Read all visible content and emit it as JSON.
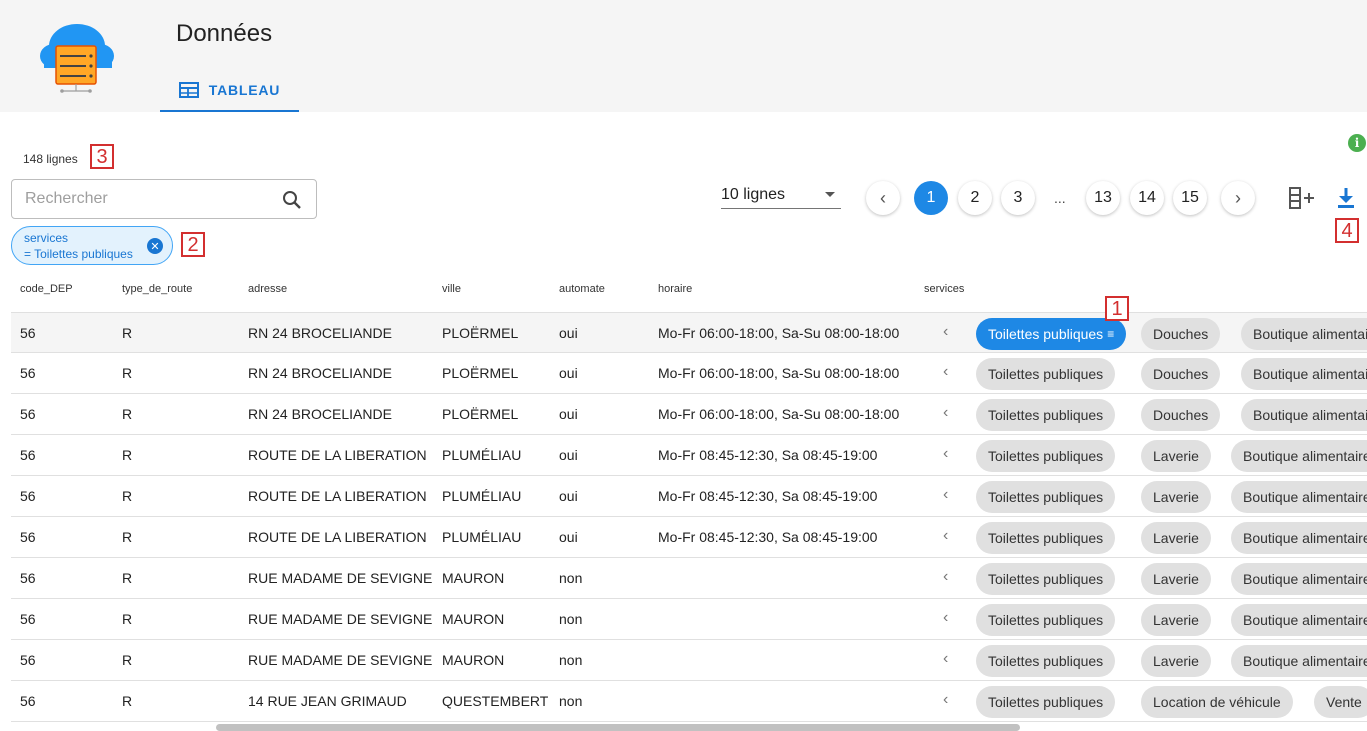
{
  "header": {
    "title": "Données",
    "tab_label": "TABLEAU"
  },
  "row_count": "148 lignes",
  "search": {
    "placeholder": "Rechercher"
  },
  "filter_chip": {
    "line1": "services",
    "line2": "= Toilettes publiques"
  },
  "rows_per_page": "10 lignes",
  "pagination": {
    "pages": [
      "1",
      "2",
      "3",
      "...",
      "13",
      "14",
      "15"
    ],
    "current": "1"
  },
  "annotations": [
    "1",
    "2",
    "3",
    "4"
  ],
  "table": {
    "columns": [
      "code_DEP",
      "type_de_route",
      "adresse",
      "ville",
      "automate",
      "horaire",
      "services"
    ],
    "rows": [
      {
        "code_DEP": "56",
        "type_de_route": "R",
        "adresse": "RN 24 BROCELIANDE",
        "ville": "PLOËRMEL",
        "automate": "oui",
        "horaire": "Mo-Fr 06:00-18:00, Sa-Su 08:00-18:00",
        "services": [
          "Toilettes publiques",
          "Douches",
          "Boutique alimentaire"
        ]
      },
      {
        "code_DEP": "56",
        "type_de_route": "R",
        "adresse": "RN 24 BROCELIANDE",
        "ville": "PLOËRMEL",
        "automate": "oui",
        "horaire": "Mo-Fr 06:00-18:00, Sa-Su 08:00-18:00",
        "services": [
          "Toilettes publiques",
          "Douches",
          "Boutique alimentaire"
        ]
      },
      {
        "code_DEP": "56",
        "type_de_route": "R",
        "adresse": "RN 24 BROCELIANDE",
        "ville": "PLOËRMEL",
        "automate": "oui",
        "horaire": "Mo-Fr 06:00-18:00, Sa-Su 08:00-18:00",
        "services": [
          "Toilettes publiques",
          "Douches",
          "Boutique alimentaire"
        ]
      },
      {
        "code_DEP": "56",
        "type_de_route": "R",
        "adresse": "ROUTE DE LA LIBERATION",
        "ville": "PLUMÉLIAU",
        "automate": "oui",
        "horaire": "Mo-Fr 08:45-12:30, Sa 08:45-19:00",
        "services": [
          "Toilettes publiques",
          "Laverie",
          "Boutique alimentaire"
        ]
      },
      {
        "code_DEP": "56",
        "type_de_route": "R",
        "adresse": "ROUTE DE LA LIBERATION",
        "ville": "PLUMÉLIAU",
        "automate": "oui",
        "horaire": "Mo-Fr 08:45-12:30, Sa 08:45-19:00",
        "services": [
          "Toilettes publiques",
          "Laverie",
          "Boutique alimentaire"
        ]
      },
      {
        "code_DEP": "56",
        "type_de_route": "R",
        "adresse": "ROUTE DE LA LIBERATION",
        "ville": "PLUMÉLIAU",
        "automate": "oui",
        "horaire": "Mo-Fr 08:45-12:30, Sa 08:45-19:00",
        "services": [
          "Toilettes publiques",
          "Laverie",
          "Boutique alimentaire"
        ]
      },
      {
        "code_DEP": "56",
        "type_de_route": "R",
        "adresse": "RUE MADAME DE SEVIGNE",
        "ville": "MAURON",
        "automate": "non",
        "horaire": "",
        "services": [
          "Toilettes publiques",
          "Laverie",
          "Boutique alimentaire"
        ]
      },
      {
        "code_DEP": "56",
        "type_de_route": "R",
        "adresse": "RUE MADAME DE SEVIGNE",
        "ville": "MAURON",
        "automate": "non",
        "horaire": "",
        "services": [
          "Toilettes publiques",
          "Laverie",
          "Boutique alimentaire"
        ]
      },
      {
        "code_DEP": "56",
        "type_de_route": "R",
        "adresse": "RUE MADAME DE SEVIGNE",
        "ville": "MAURON",
        "automate": "non",
        "horaire": "",
        "services": [
          "Toilettes publiques",
          "Laverie",
          "Boutique alimentaire"
        ]
      },
      {
        "code_DEP": "56",
        "type_de_route": "R",
        "adresse": "14 RUE JEAN GRIMAUD",
        "ville": "QUESTEMBERT",
        "automate": "non",
        "horaire": "",
        "services": [
          "Toilettes publiques",
          "Location de véhicule",
          "Vente"
        ]
      }
    ]
  },
  "icons": {
    "logo": "cloud-server-logo",
    "tab": "table-icon",
    "search": "search-icon",
    "info": "info-icon",
    "add_column": "add-column-icon",
    "download": "download-icon",
    "filter": "filter-icon",
    "chevron": "chevron-left-icon"
  },
  "colors": {
    "accent": "#1976d2",
    "active_page": "#1e88e5",
    "info": "#4caf50",
    "annotation": "#d32f2f",
    "chip": "#e0e0e0"
  }
}
